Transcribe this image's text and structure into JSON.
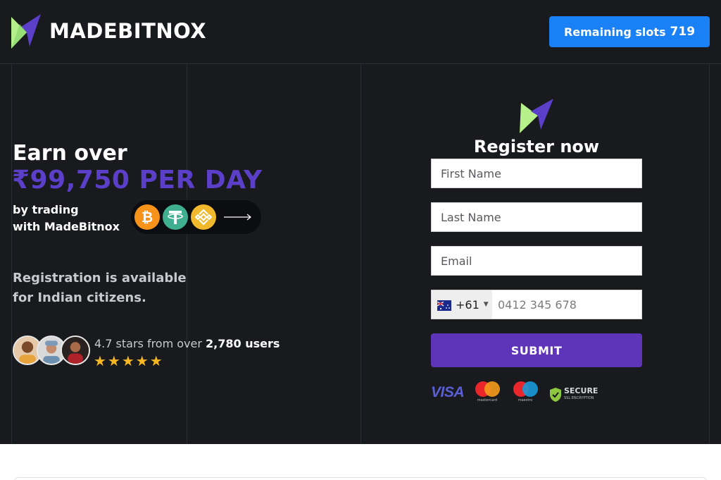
{
  "header": {
    "brand": "MADEBITNOX",
    "slots_label": "Remaining slots",
    "slots_count": "719"
  },
  "hero": {
    "line1": "Earn over",
    "amount": "₹99,750 PER DAY",
    "trading_line1": "by trading",
    "trading_line2": "with MadeBitnox",
    "coins": [
      "bitcoin-icon",
      "tether-icon",
      "binance-icon"
    ],
    "registration_line1": "Registration is available",
    "registration_line2": "for Indian citizens.",
    "rating_text": "4.7 stars from over",
    "rating_users": "2,780 users",
    "stars": "★★★★★"
  },
  "form": {
    "title": "Register now",
    "first_name_placeholder": "First Name",
    "last_name_placeholder": "Last Name",
    "email_placeholder": "Email",
    "country_code": "+61",
    "phone_placeholder": "0412 345 678",
    "submit_label": "SUBMIT",
    "payment_badges": {
      "visa": "VISA",
      "mastercard": "mastercard",
      "maestro": "maestro",
      "secure_title": "SECURE",
      "secure_sub": "SSL ENCRYPTION"
    }
  },
  "colors": {
    "background": "#181a1e",
    "accent_purple": "#5b3fc8",
    "button_blue": "#1a80f5",
    "submit_purple": "#5e35b8",
    "star": "#f5b722"
  }
}
